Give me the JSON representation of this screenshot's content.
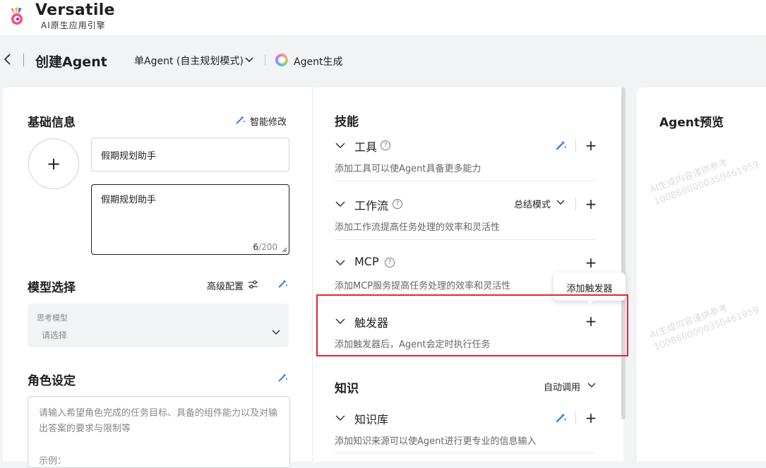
{
  "brand": {
    "name": "Versatile",
    "subtitle": "AI原生应用引擎"
  },
  "header": {
    "title": "创建Agent",
    "mode": "单Agent (自主规划模式)",
    "generate": "Agent生成"
  },
  "basic": {
    "title": "基础信息",
    "smart_edit": "智能修改",
    "avatar_add": "+",
    "name_value": "假期规划助手",
    "desc_value": "假期规划助手",
    "counter_current": "6",
    "counter_max": "/200"
  },
  "model": {
    "title": "模型选择",
    "advanced": "高级配置",
    "field_label": "思考模型",
    "placeholder": "请选择"
  },
  "role": {
    "title": "角色设定",
    "placeholder": "请输入希望角色完成的任务目标、具备的组件能力以及对输出答案的要求与限制等",
    "placeholder_cut": "示例："
  },
  "skills": {
    "title": "技能",
    "tools": {
      "label": "工具",
      "desc": "添加工具可以使Agent具备更多能力"
    },
    "workflow": {
      "label": "工作流",
      "desc": "添加工作流提高任务处理的效率和灵活性",
      "mode": "总结模式"
    },
    "mcp": {
      "label": "MCP",
      "desc": "添加MCP服务提高任务处理的效率和灵活性"
    },
    "trigger": {
      "label": "触发器",
      "desc": "添加触发器后，Agent会定时执行任务"
    },
    "plus": "+"
  },
  "tooltip": {
    "text": "添加触发器"
  },
  "knowledge": {
    "title": "知识",
    "mode": "自动调用",
    "kb": {
      "label": "知识库",
      "desc": "添加知识来源可以使Agent进行更专业的信息输入"
    }
  },
  "preview": {
    "title": "Agent预览",
    "watermark_line1": "AI生成内容谨供参考",
    "watermark_line2": "1008600000350461959"
  },
  "colors": {
    "highlight": "#e0282e",
    "accent_blue": "#1f6fe5",
    "page_bg": "#f2f3f5"
  }
}
